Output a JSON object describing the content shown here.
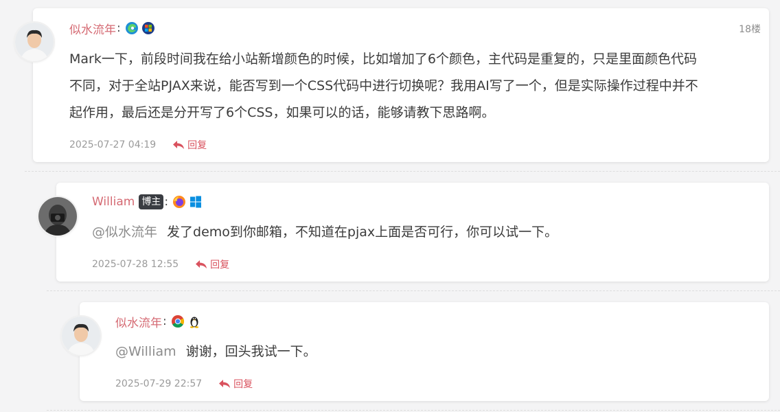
{
  "comments": [
    {
      "author": "似水流年",
      "colon": ":",
      "badge": "",
      "browser_icon": "edge-icon",
      "os_icon": "windows-xp-icon",
      "floor": "18楼",
      "mention": "",
      "content_lines": [
        "Mark一下，前段时间我在给小站新增颜色的时候，比如增加了6个颜色，主代码是重复的，只是里面颜色代码",
        "不同，对于全站PJAX来说，能否写到一个CSS代码中进行切换呢？我用AI写了一个，但是实际操作过程中并不",
        "起作用，最后还是分开写了6个CSS，如果可以的话，能够请教下思路啊。"
      ],
      "time": "2025-07-27 04:19",
      "reply_label": "回复"
    },
    {
      "author": "William",
      "colon": ":",
      "badge": "博主",
      "browser_icon": "firefox-icon",
      "os_icon": "windows-icon",
      "floor": "",
      "mention": "@似水流年",
      "content": "发了demo到你邮箱，不知道在pjax上面是否可行，你可以试一下。",
      "time": "2025-07-28 12:55",
      "reply_label": "回复"
    },
    {
      "author": "似水流年",
      "colon": ":",
      "badge": "",
      "browser_icon": "chrome-icon",
      "os_icon": "linux-icon",
      "floor": "",
      "mention": "@William",
      "content": "谢谢，回头我试一下。",
      "time": "2025-07-29 22:57",
      "reply_label": "回复"
    }
  ],
  "colors": {
    "author": "#d56a73",
    "reply": "#d9525e",
    "badge_bg": "#3a3d42",
    "text": "#3b3b3b",
    "muted": "#9a9a9a"
  }
}
